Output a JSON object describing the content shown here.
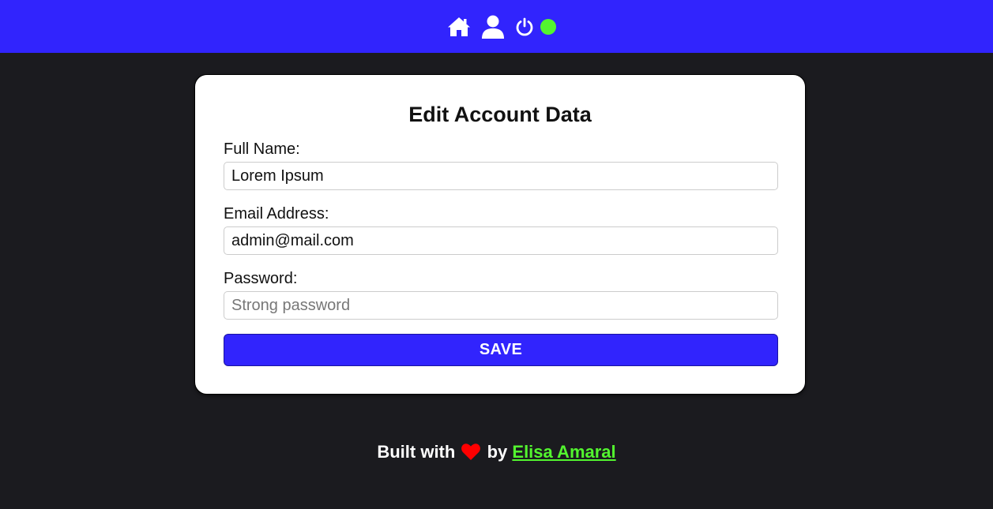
{
  "nav": {
    "icons": [
      "home-icon",
      "user-icon",
      "power-icon"
    ],
    "status_color": "#53f52f"
  },
  "form": {
    "title": "Edit Account Data",
    "full_name": {
      "label": "Full Name:",
      "value": "Lorem Ipsum"
    },
    "email": {
      "label": "Email Address:",
      "value": "admin@mail.com"
    },
    "password": {
      "label": "Password:",
      "placeholder": "Strong password",
      "value": ""
    },
    "save_label": "SAVE"
  },
  "footer": {
    "prefix": "Built with",
    "icon": "heart-icon",
    "middle": "by",
    "author": "Elisa Amaral"
  },
  "colors": {
    "accent": "#3124fd",
    "background": "#1b1b1f",
    "link": "#53f52f",
    "heart": "#ff0000"
  }
}
